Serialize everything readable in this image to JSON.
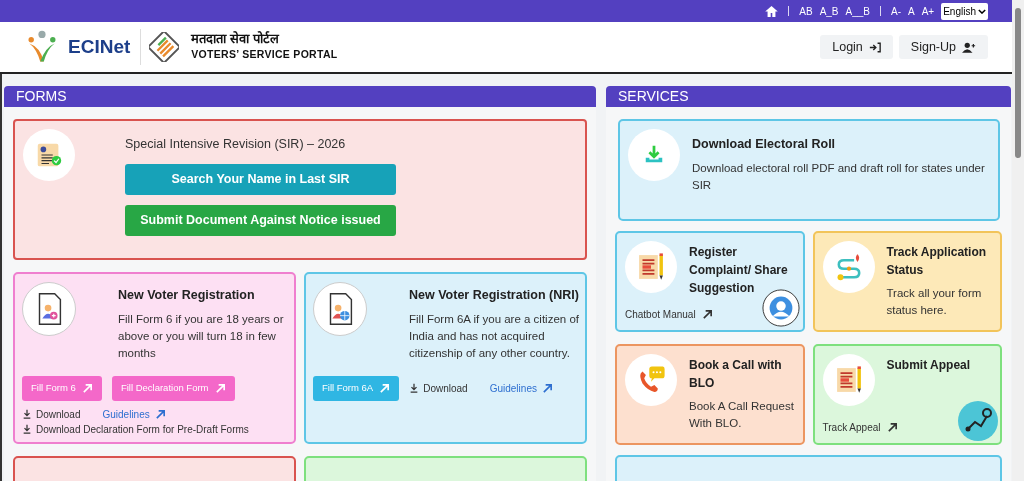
{
  "top_bar": {
    "contrast_options": [
      "AB",
      "A_B",
      "A__B"
    ],
    "font_sizes": [
      "A-",
      "A",
      "A+"
    ],
    "language": "English"
  },
  "header": {
    "logo_text": "ECINet",
    "portal_hindi": "मतदाता सेवा पोर्टल",
    "portal_name": "VOTERS’ SERVICE PORTAL",
    "buttons": [
      {
        "label": "Login",
        "kind": "login"
      },
      {
        "label": "Sign-Up",
        "kind": "signup"
      }
    ]
  },
  "forms": {
    "title": "FORMS",
    "sir_card": {
      "title": "Special Intensive Revision (SIR) – 2026",
      "buttons": [
        {
          "label": "Search Your Name in Last SIR",
          "color": "#17a2b8"
        },
        {
          "label": "Submit Document Against Notice issued",
          "color": "#28a745"
        }
      ]
    },
    "cards": [
      {
        "title": "New Voter Registration",
        "description": "Fill Form 6 if you are 18 years or above or you will turn 18 in few months",
        "color": "#ef7fcf",
        "actions": [
          {
            "label": "Fill Form 6",
            "kind": "filled"
          },
          {
            "label": "Fill Declaration Form",
            "kind": "filled"
          },
          {
            "label": "Download",
            "kind": "download"
          },
          {
            "label": "Guidelines",
            "kind": "link"
          }
        ],
        "footer_link": "Download Declaration Form for Pre-Draft Forms"
      },
      {
        "title": "New Voter Registration (NRI)",
        "description": "Fill Form 6A if you are a citizen of India and has not acquired citizenship of any other country.",
        "color": "#5ec6e6",
        "actions": [
          {
            "label": "Fill Form 6A",
            "kind": "filled"
          },
          {
            "label": "Download",
            "kind": "download"
          },
          {
            "label": "Guidelines",
            "kind": "link"
          }
        ]
      }
    ],
    "more_cards": [
      {
        "color": "#d9534f"
      },
      {
        "color": "#7ee07e"
      }
    ]
  },
  "services": {
    "title": "SERVICES",
    "wide_card": {
      "title": "Download Electoral Roll",
      "description": "Download electoral roll PDF and draft roll for states under SIR"
    },
    "cards": [
      {
        "title": "Register Complaint/ Share Suggestion",
        "color": "#5ec6e6",
        "link": "Chatbot Manual"
      },
      {
        "title": "Track Application Status",
        "description": "Track all your form status here.",
        "color": "#f2c45a"
      },
      {
        "title": "Book a Call with BLO",
        "description": "Book A Call Request With BLO.",
        "color": "#ec9560"
      },
      {
        "title": "Submit Appeal",
        "color": "#7ee07e",
        "link": "Track Appeal"
      }
    ]
  }
}
